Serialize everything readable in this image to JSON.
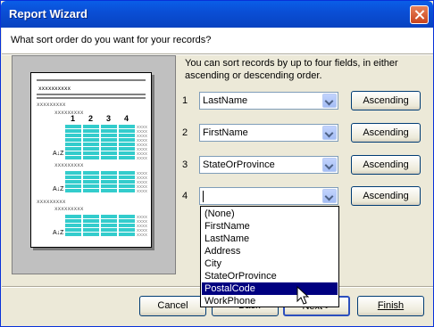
{
  "window": {
    "title": "Report Wizard"
  },
  "header": {
    "question": "What sort order do you want for your records?"
  },
  "instruction": "You can sort records by up to four fields, in either ascending or descending order.",
  "preview": {
    "placeholder": "xxxxxxxxxx",
    "column_numbers": [
      "1",
      "2",
      "3",
      "4"
    ]
  },
  "sort_rows": [
    {
      "number": "1",
      "field": "LastName",
      "order": "Ascending"
    },
    {
      "number": "2",
      "field": "FirstName",
      "order": "Ascending"
    },
    {
      "number": "3",
      "field": "StateOrProvince",
      "order": "Ascending"
    },
    {
      "number": "4",
      "field": "",
      "order": "Ascending"
    }
  ],
  "dropdown": {
    "options": [
      "(None)",
      "FirstName",
      "LastName",
      "Address",
      "City",
      "StateOrProvince",
      "PostalCode",
      "WorkPhone"
    ],
    "highlighted": "PostalCode"
  },
  "footer": {
    "cancel": "Cancel",
    "back": "< Back",
    "next": "Next >",
    "finish": "Finish"
  },
  "colors": {
    "title_bar": "#0a4fd6",
    "highlight": "#000080",
    "preview_cells": "#33cccc"
  }
}
